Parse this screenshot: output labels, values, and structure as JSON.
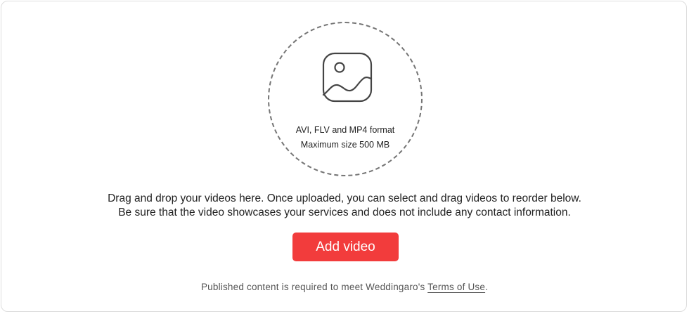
{
  "dropzone": {
    "icon": "image-icon",
    "format_text": "AVI, FLV and MP4 format",
    "size_text": "Maximum size 500 MB"
  },
  "instructions": {
    "line1": "Drag and drop your videos here. Once uploaded, you can select and drag videos to reorder below.",
    "line2": "Be sure that the video showcases your services and does not include any contact information."
  },
  "add_button": {
    "label": "Add video",
    "color": "#f23c3c"
  },
  "footer": {
    "prefix": "Published content is required to meet Weddingaro's ",
    "link_label": "Terms of Use",
    "suffix": "."
  }
}
